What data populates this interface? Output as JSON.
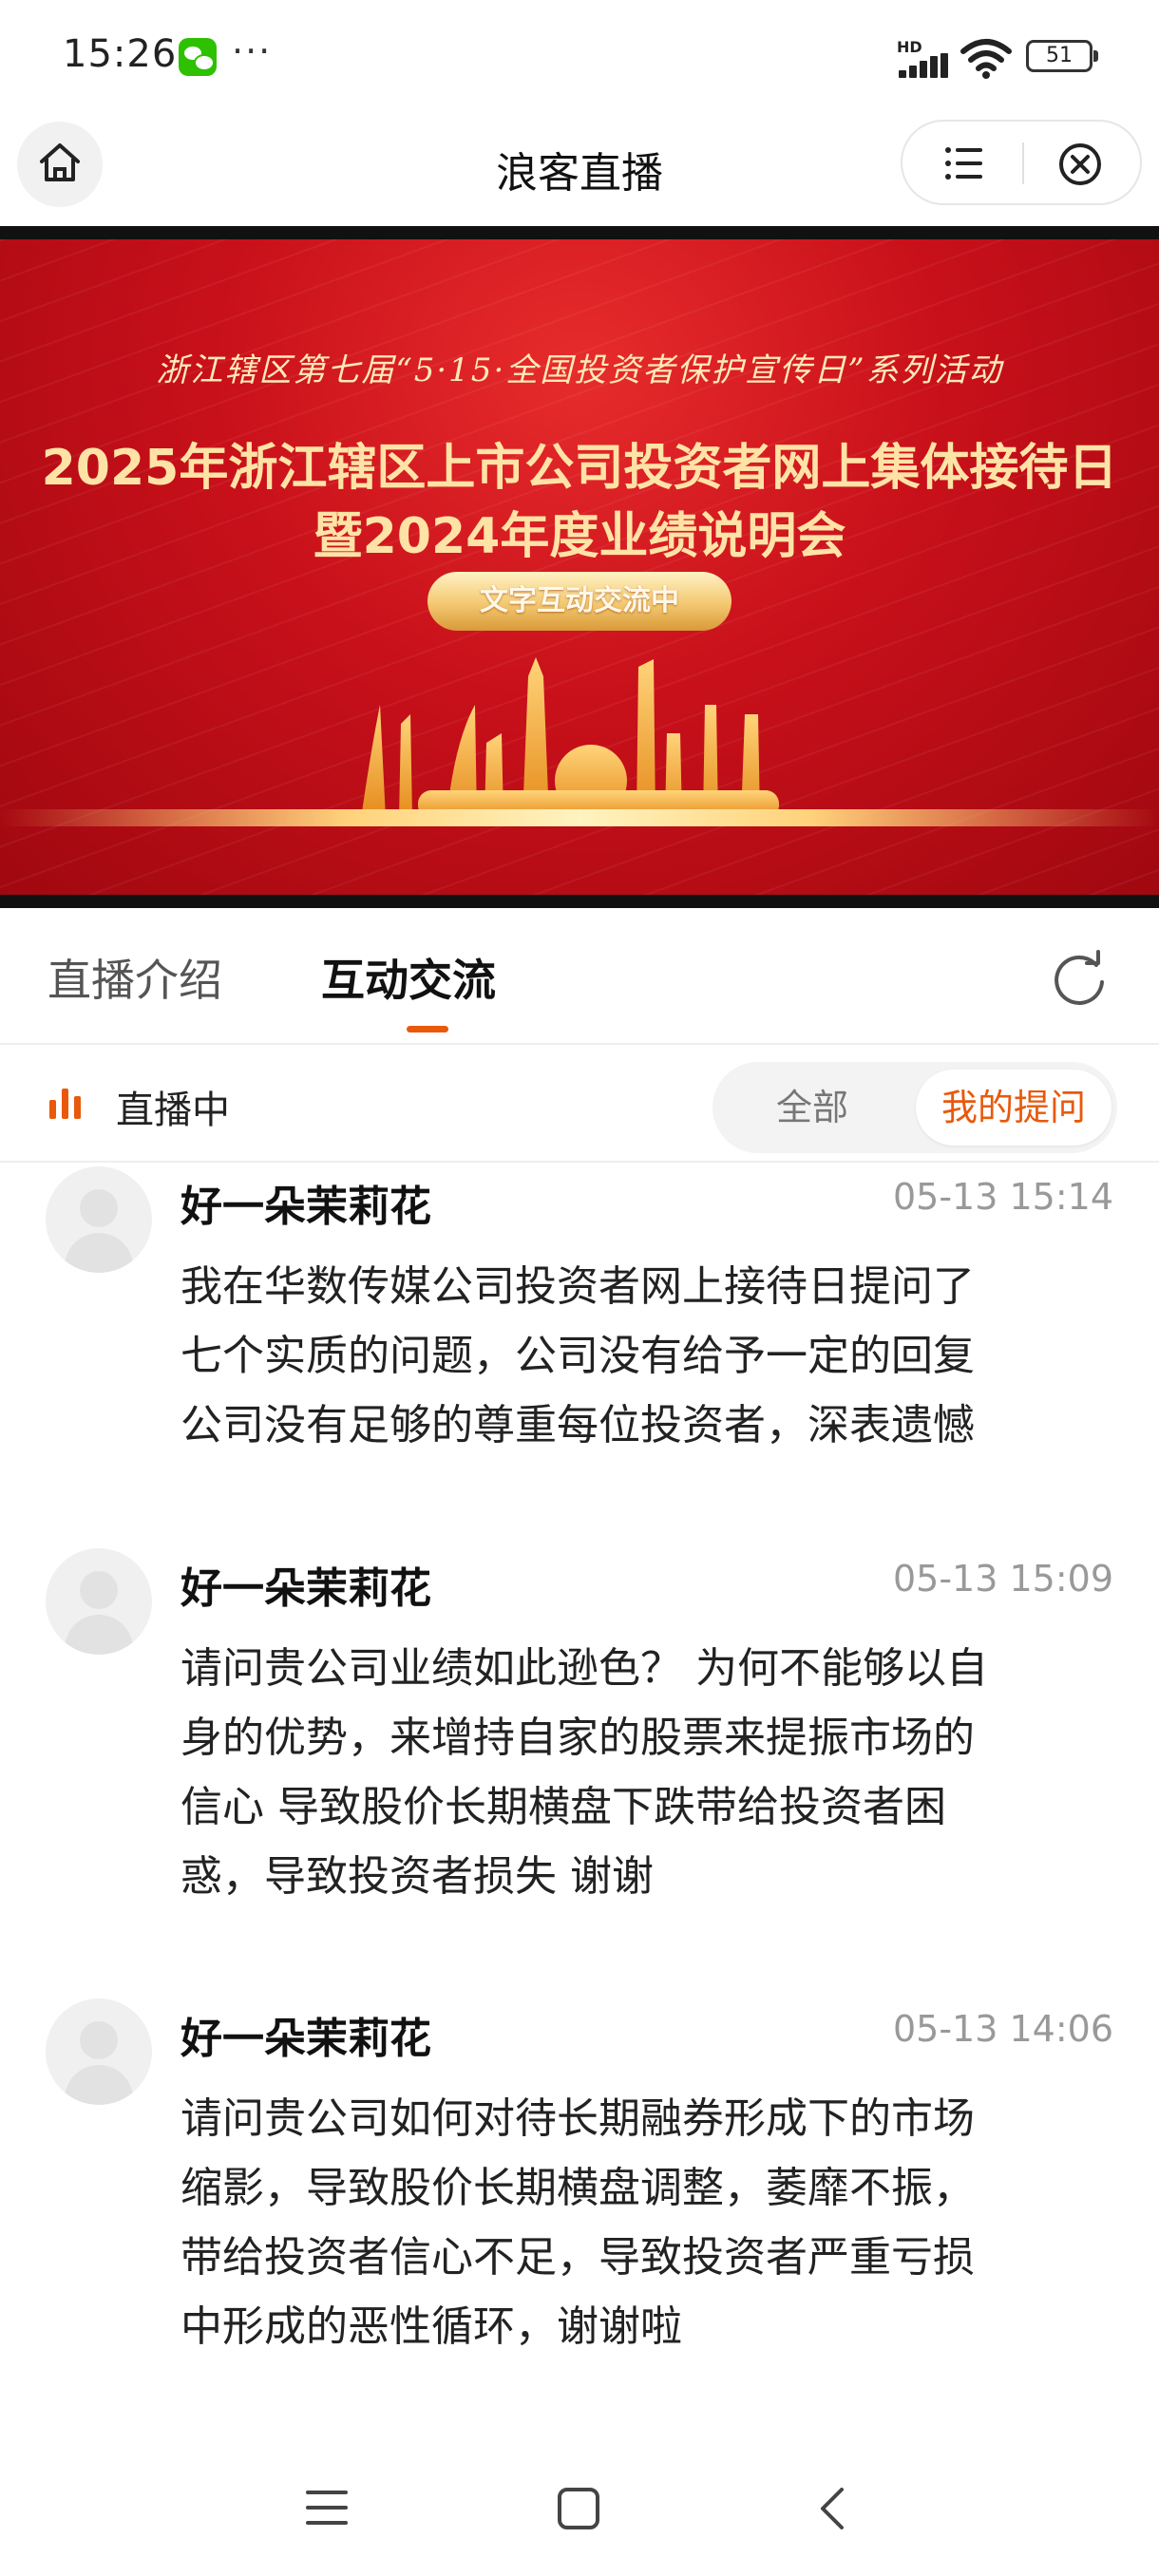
{
  "status_bar": {
    "time": "15:26",
    "more": "···",
    "network": "HD",
    "battery": "51",
    "icons": [
      "wechat-icon",
      "signal-icon",
      "wifi-icon",
      "battery-icon"
    ]
  },
  "titlebar": {
    "title": "浪客直播",
    "icons": [
      "home-icon",
      "menu-list-icon",
      "close-circle-icon"
    ]
  },
  "banner": {
    "subtitle": "浙江辖区第七届“5·15·全国投资者保护宣传日”系列活动",
    "title_line1": "2025年浙江辖区上市公司投资者网上集体接待日",
    "title_line2": "暨2024年度业绩说明会",
    "status_pill": "文字互动交流中",
    "colors": {
      "background": "#c8101a",
      "title": "#ffe3a6",
      "pill": "#f3c870"
    }
  },
  "tabs": {
    "items": [
      {
        "label": "直播介绍",
        "active": false
      },
      {
        "label": "互动交流",
        "active": true
      }
    ],
    "accent": "#e8590c"
  },
  "live_row": {
    "label": "直播中",
    "filter": {
      "all": "全部",
      "mine": "我的提问",
      "selected": "我的提问"
    }
  },
  "messages": [
    {
      "name": "好一朵茉莉花",
      "time": "05-13 15:14",
      "lines": [
        "我在华数传媒公司投资者网上接待日提问了",
        "七个实质的问题，公司没有给予一定的回复",
        "公司没有足够的尊重每位投资者，深表遗憾"
      ]
    },
    {
      "name": "好一朵茉莉花",
      "time": "05-13 15:09",
      "lines": [
        "请问贵公司业绩如此逊色？ 为何不能够以自",
        "身的优势，来增持自家的股票来提振市场的",
        "信心 导致股价长期横盘下跌带给投资者困",
        "惑，导致投资者损失 谢谢"
      ]
    },
    {
      "name": "好一朵茉莉花",
      "time": "05-13 14:06",
      "lines": [
        "请问贵公司如何对待长期融券形成下的市场",
        "缩影，导致股价长期横盘调整，萎靡不振，",
        "带给投资者信心不足，导致投资者严重亏损",
        "中形成的恶性循环，谢谢啦"
      ]
    }
  ],
  "nav_bar": {
    "icons": [
      "recent-apps-icon",
      "home-square-icon",
      "back-icon"
    ]
  }
}
